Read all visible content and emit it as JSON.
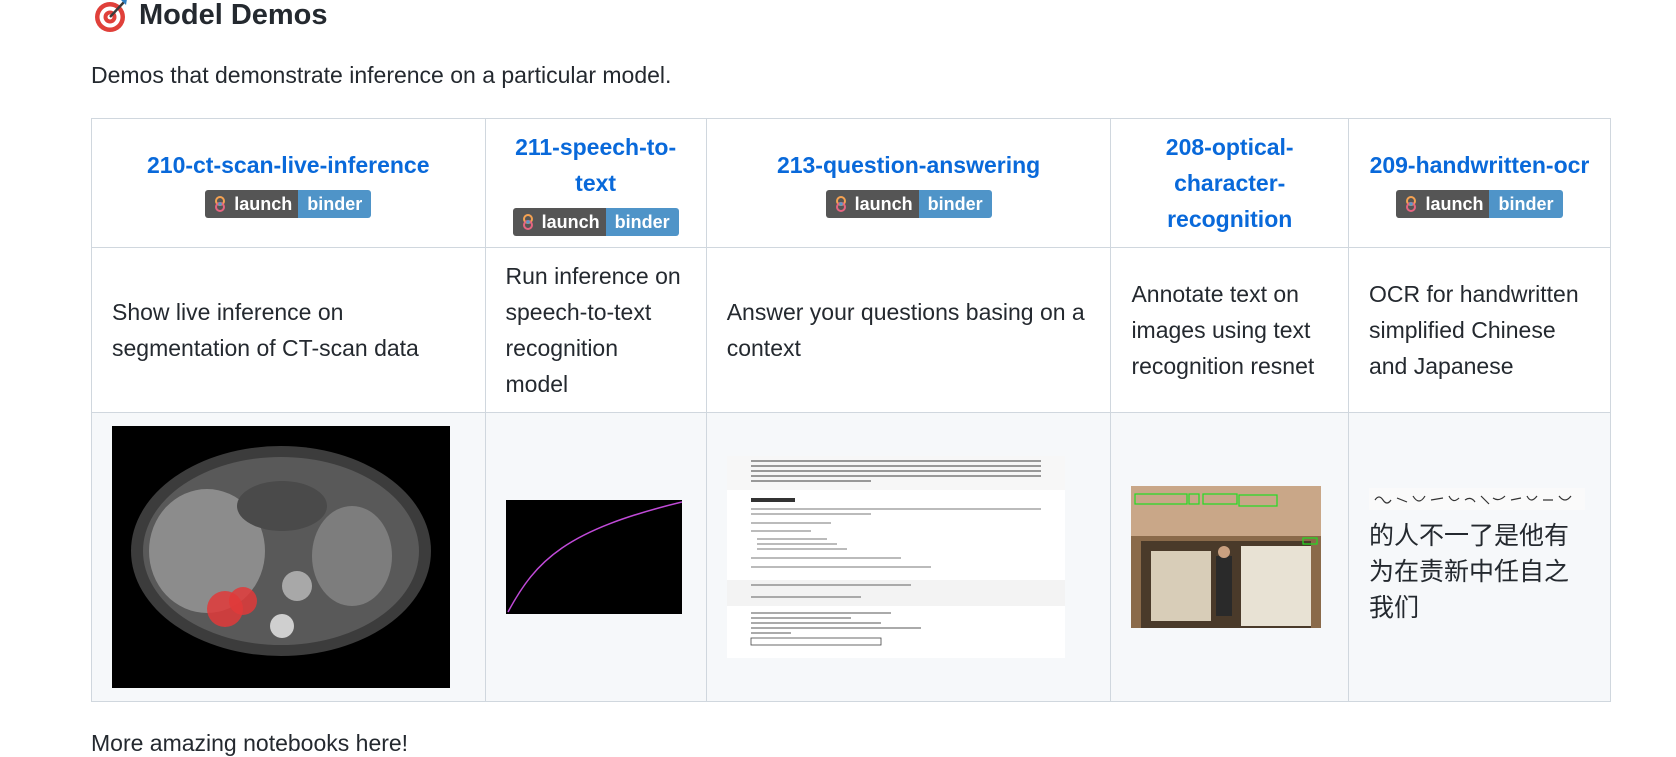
{
  "section": {
    "icon": "dart-target-icon",
    "title": "Model Demos",
    "description": "Demos that demonstrate inference on a particular model."
  },
  "badge": {
    "left": "launch",
    "right": "binder"
  },
  "demos": [
    {
      "title": "210-ct-scan-live-inference",
      "has_badge": true,
      "text": "Show live inference on segmentation of CT-scan data"
    },
    {
      "title": "211-speech-to-text",
      "has_badge": true,
      "text": "Run inference on speech-to-text recognition model"
    },
    {
      "title": "213-question-answering",
      "has_badge": true,
      "text": "Answer your questions basing on a context"
    },
    {
      "title": "208-optical-character-recognition",
      "has_badge": false,
      "text": "Annotate text on images using text recognition resnet"
    },
    {
      "title": "209-handwritten-ocr",
      "has_badge": true,
      "text": "OCR for handwritten simplified Chinese and Japanese",
      "image_text": "的人不一了是他有为在责新中任自之我们"
    }
  ],
  "footer": {
    "text": "More amazing notebooks here!"
  },
  "colors": {
    "link": "#0969da",
    "badge_left": "#555555",
    "badge_right": "#4f94c8",
    "border": "#d0d7de"
  }
}
